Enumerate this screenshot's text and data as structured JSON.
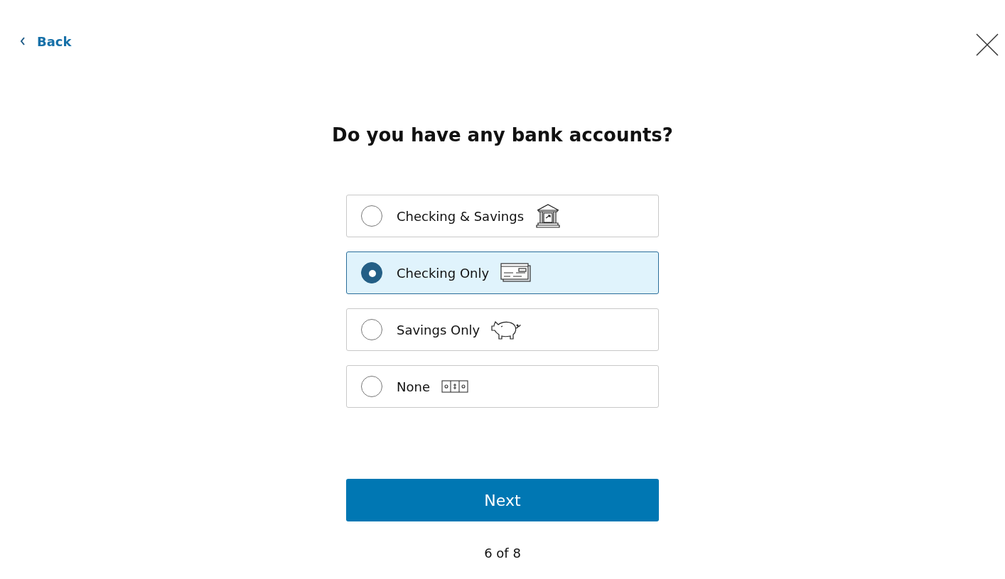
{
  "back": {
    "label": "Back"
  },
  "title": "Do you have any bank accounts?",
  "options": [
    {
      "label": "Checking & Savings",
      "kind": "bank",
      "selected": false
    },
    {
      "label": "Checking Only",
      "kind": "check",
      "selected": true
    },
    {
      "label": "Savings Only",
      "kind": "piggy",
      "selected": false
    },
    {
      "label": "None",
      "kind": "cash",
      "selected": false
    }
  ],
  "next_button": "Next",
  "progress": "6 of 8"
}
